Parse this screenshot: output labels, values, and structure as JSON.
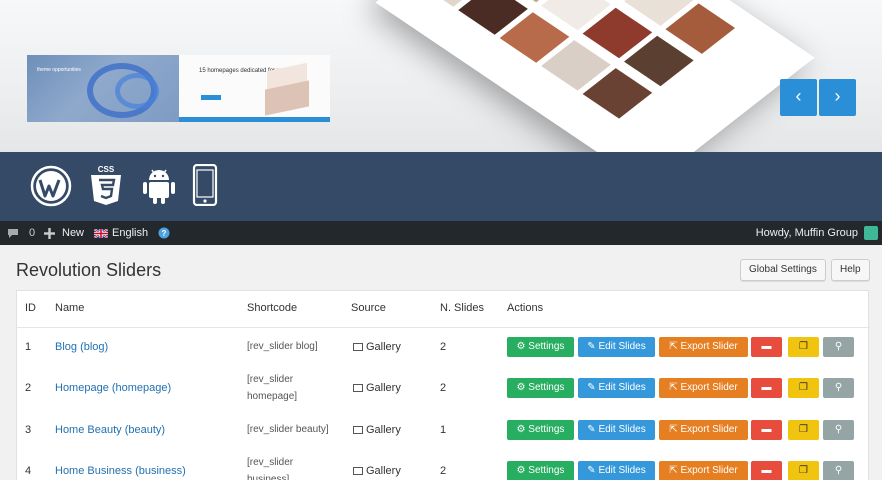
{
  "hero": {
    "thumb1_text": "theme opportunities",
    "thumb2_text": "15 homepages dedicated for you",
    "prev_icon": "chevron-left-icon",
    "next_icon": "chevron-right-icon",
    "prev_glyph": "‹",
    "next_glyph": "›",
    "accent": "#2a8fd6"
  },
  "tech_icons": [
    "wordpress-icon",
    "css3-icon",
    "android-icon",
    "mobile-phone-icon"
  ],
  "tech_labels": {
    "css": "CSS"
  },
  "adminbar": {
    "comments_count": "0",
    "new_label": "New",
    "language_label": "English",
    "howdy": "Howdy, Muffin Group"
  },
  "page": {
    "title": "Revolution Sliders",
    "global_settings": "Global Settings",
    "help": "Help"
  },
  "table": {
    "headers": {
      "id": "ID",
      "name": "Name",
      "shortcode": "Shortcode",
      "source": "Source",
      "slides": "N. Slides",
      "actions": "Actions"
    },
    "rows": [
      {
        "id": "1",
        "name": "Blog (blog)",
        "shortcode_1": "[rev_slider blog]",
        "shortcode_2": "",
        "source": "Gallery",
        "slides": "2"
      },
      {
        "id": "2",
        "name": "Homepage (homepage)",
        "shortcode_1": "[rev_slider",
        "shortcode_2": "homepage]",
        "source": "Gallery",
        "slides": "2"
      },
      {
        "id": "3",
        "name": "Home Beauty (beauty)",
        "shortcode_1": "[rev_slider beauty]",
        "shortcode_2": "",
        "source": "Gallery",
        "slides": "1"
      },
      {
        "id": "4",
        "name": "Home Business (business)",
        "shortcode_1": "[rev_slider",
        "shortcode_2": "business]",
        "source": "Gallery",
        "slides": "2"
      }
    ],
    "actions": {
      "settings": "Settings",
      "edit": "Edit Slides",
      "export": "Export Slider"
    },
    "colors": {
      "settings": "#27ae60",
      "edit": "#3498db",
      "export": "#e67e22",
      "delete": "#e74c3c",
      "duplicate": "#f1c40f",
      "preview": "#95a5a6"
    }
  }
}
